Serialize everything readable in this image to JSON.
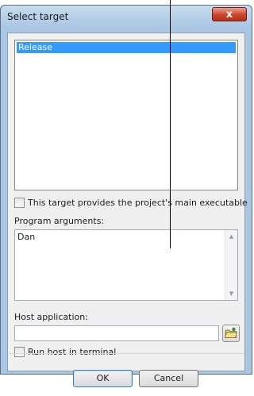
{
  "window": {
    "title": "Select target",
    "close_label": "x"
  },
  "targets": {
    "items": [
      "Release"
    ]
  },
  "main_executable": {
    "label": "This target provides the project's main executable",
    "checked": false
  },
  "program_arguments": {
    "label": "Program arguments:",
    "value": "Dan"
  },
  "host_application": {
    "label": "Host application:",
    "value": "",
    "browse_icon": "folder-open-icon"
  },
  "run_in_terminal": {
    "label": "Run host in terminal",
    "checked": false
  },
  "buttons": {
    "ok": "OK",
    "cancel": "Cancel"
  },
  "colors": {
    "selection": "#3399ff",
    "title_bar": "#a9c6e3",
    "close_button": "#c9452d"
  }
}
